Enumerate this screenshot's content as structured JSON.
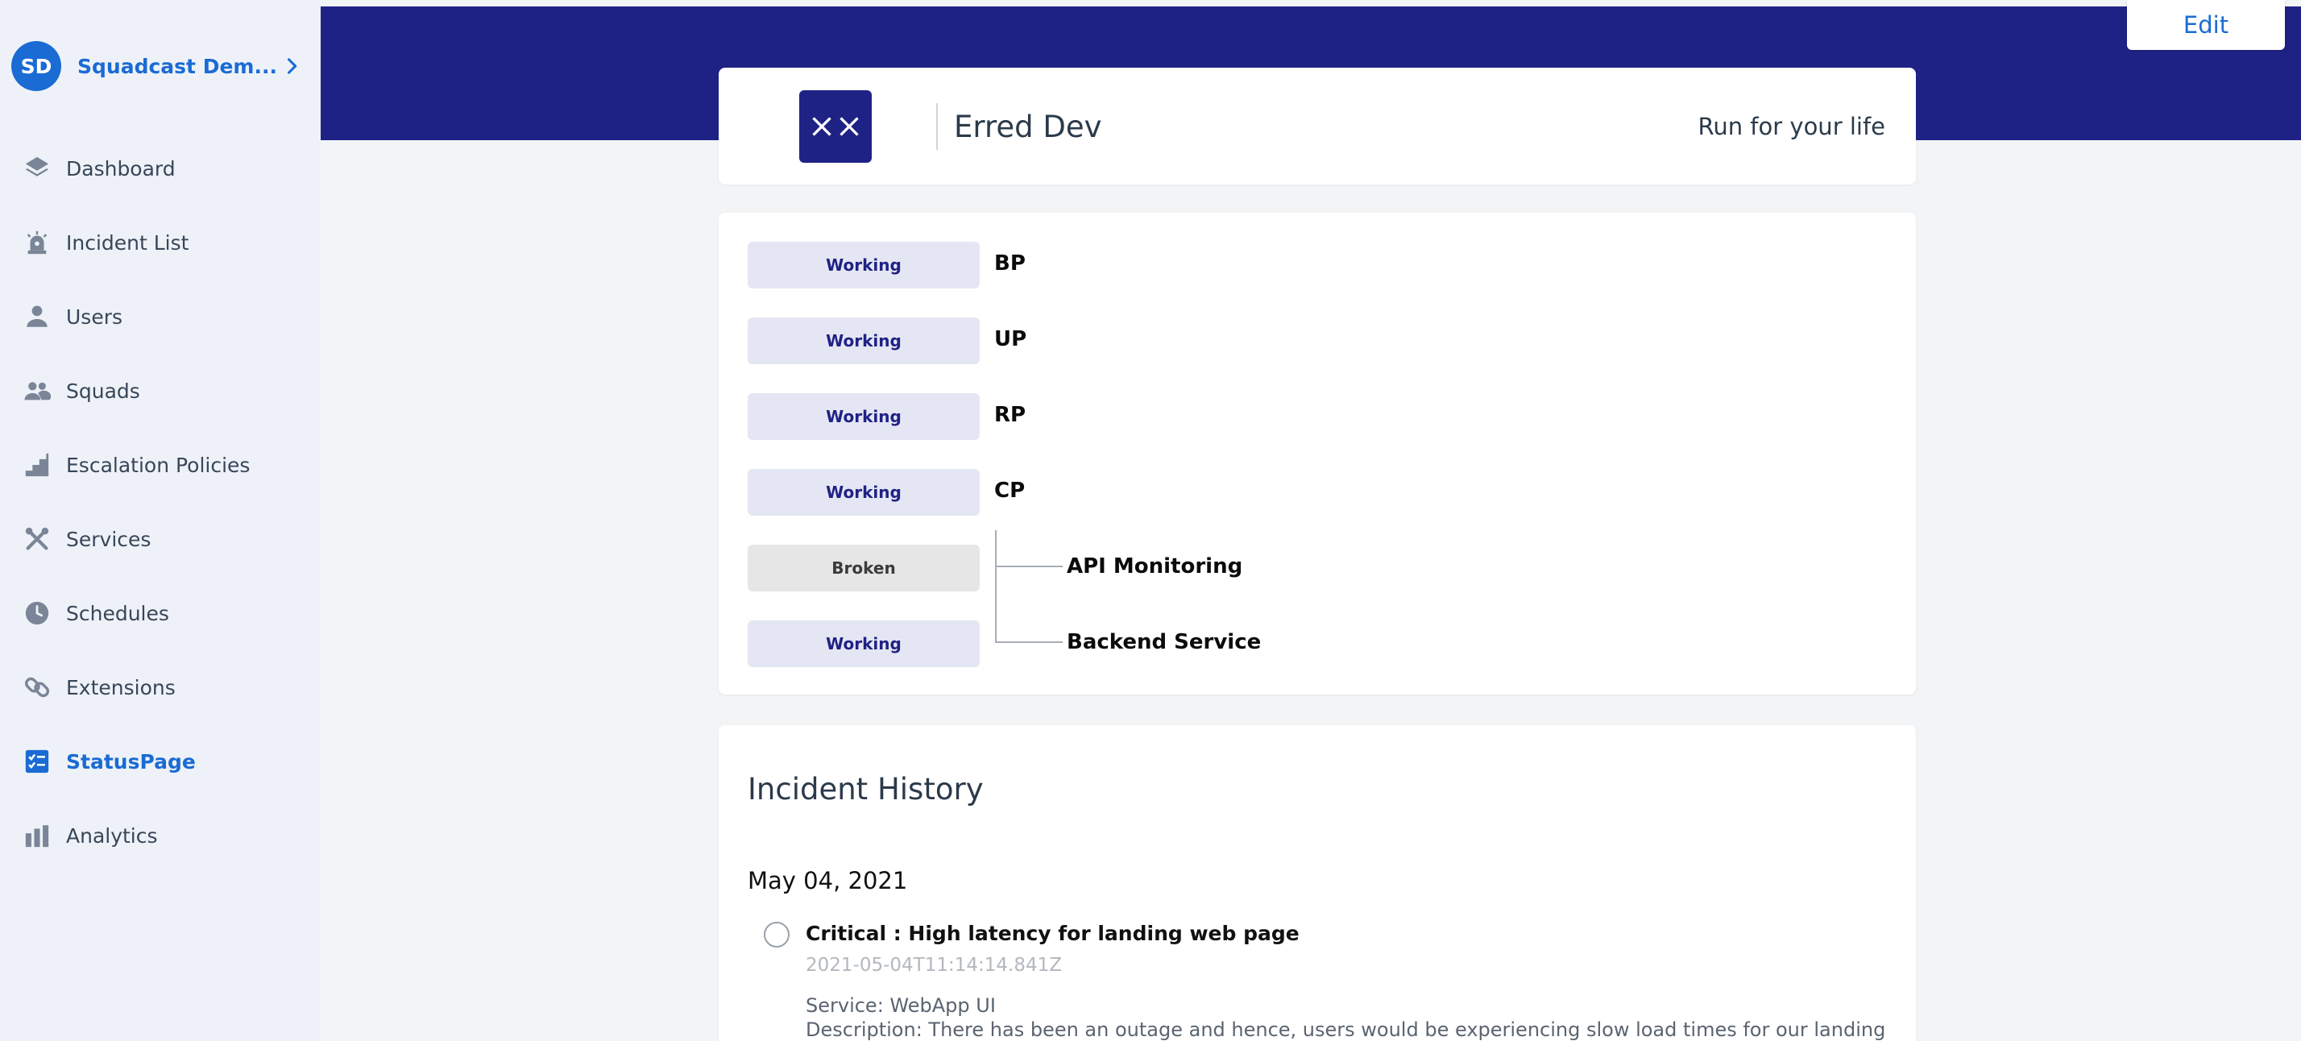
{
  "sidebar": {
    "org": {
      "initials": "SD",
      "name": "Squadcast Dem..."
    },
    "items": [
      {
        "label": "Dashboard",
        "icon": "layers-icon"
      },
      {
        "label": "Incident List",
        "icon": "alarm-icon"
      },
      {
        "label": "Users",
        "icon": "user-icon"
      },
      {
        "label": "Squads",
        "icon": "users-group-icon"
      },
      {
        "label": "Escalation Policies",
        "icon": "stairs-icon"
      },
      {
        "label": "Services",
        "icon": "tools-icon"
      },
      {
        "label": "Schedules",
        "icon": "clock-icon"
      },
      {
        "label": "Extensions",
        "icon": "link-icon"
      },
      {
        "label": "StatusPage",
        "icon": "checklist-icon",
        "active": true
      },
      {
        "label": "Analytics",
        "icon": "bar-chart-icon"
      }
    ]
  },
  "toolbar": {
    "edit_label": "Edit"
  },
  "status_page": {
    "name": "Erred Dev",
    "tagline": "Run for your life"
  },
  "components": [
    {
      "status": "Working",
      "name": "BP"
    },
    {
      "status": "Working",
      "name": "UP"
    },
    {
      "status": "Working",
      "name": "RP"
    },
    {
      "status": "Working",
      "name": "CP"
    },
    {
      "status": "Broken",
      "name": "API Monitoring"
    },
    {
      "status": "Working",
      "name": "Backend Service"
    }
  ],
  "incident_history": {
    "title": "Incident History",
    "date": "May 04, 2021",
    "incident": {
      "title": "Critical : High latency for landing web page",
      "timestamp": "2021-05-04T11:14:14.841Z",
      "service": "Service: WebApp UI",
      "description": "Description: There has been an outage and hence, users would be experiencing slow load times for our landing"
    }
  },
  "colors": {
    "brand": "#1f2285",
    "accent": "#1a6bd4",
    "working_bg": "#e5e6f3",
    "broken_bg": "#e6e6e6"
  }
}
